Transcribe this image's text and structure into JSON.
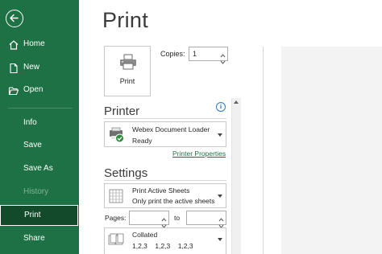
{
  "sidebar": {
    "items": [
      {
        "label": "Home",
        "icon": "home-icon"
      },
      {
        "label": "New",
        "icon": "new-document-icon"
      },
      {
        "label": "Open",
        "icon": "open-folder-icon"
      },
      {
        "label": "Info"
      },
      {
        "label": "Save"
      },
      {
        "label": "Save As"
      },
      {
        "label": "History",
        "disabled": true
      },
      {
        "label": "Print",
        "selected": true
      },
      {
        "label": "Share"
      }
    ]
  },
  "main": {
    "title": "Print",
    "print_button_label": "Print",
    "copies_label": "Copies:",
    "copies_value": "1"
  },
  "printer": {
    "header": "Printer",
    "name": "Webex Document Loader",
    "status": "Ready",
    "properties_link": "Printer Properties"
  },
  "settings": {
    "header": "Settings",
    "scope_title": "Print Active Sheets",
    "scope_desc": "Only print the active sheets",
    "pages_label": "Pages:",
    "to_label": "to",
    "pages_from": "",
    "pages_to": "",
    "collate_title": "Collated",
    "collate_desc": "1,2,3    1,2,3    1,2,3"
  },
  "colors": {
    "sidebar": "#1e7145",
    "selected": "#134a2c",
    "link": "#1e7145",
    "info": "#2b79c2"
  }
}
